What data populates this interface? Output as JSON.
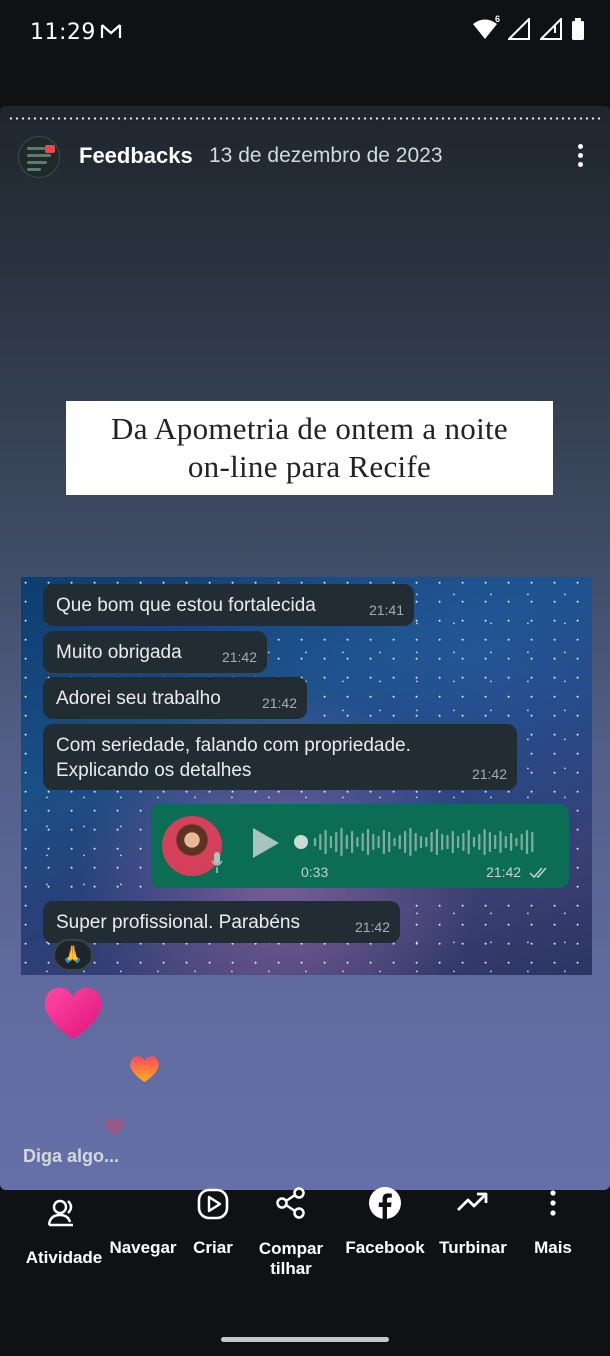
{
  "status_bar": {
    "time": "11:29",
    "wifi_badge": "6"
  },
  "story": {
    "page_name": "Feedbacks",
    "date": "13 de dezembro de 2023",
    "caption_line1": "Da Apometria de ontem a noite",
    "caption_line2": "on-line para Recife",
    "reply_placeholder": "Diga algo..."
  },
  "chat": {
    "messages": [
      {
        "text": "Que bom que estou fortalecida",
        "time": "21:41"
      },
      {
        "text": "Muito obrigada",
        "time": "21:42"
      },
      {
        "text": "Adorei seu trabalho",
        "time": "21:42"
      },
      {
        "text_line1": "Com seriedade,  falando com propriedade.",
        "text_line2": "Explicando os detalhes",
        "time": "21:42"
      },
      {
        "text": "Super profissional.  Parabéns",
        "time": "21:42"
      }
    ],
    "audio": {
      "duration": "0:33",
      "time": "21:42"
    },
    "reaction": "🙏"
  },
  "actions": [
    {
      "label": "Atividade",
      "icon": "activity-icon"
    },
    {
      "label": "Navegar",
      "icon": "navigate-icon"
    },
    {
      "label": "Criar",
      "icon": "create-play-icon"
    },
    {
      "label_line1": "Compar",
      "label_line2": "tilhar",
      "icon": "share-icon"
    },
    {
      "label": "Facebook",
      "icon": "facebook-icon"
    },
    {
      "label": "Turbinar",
      "icon": "boost-trend-icon"
    },
    {
      "label": "Mais",
      "icon": "more-vertical-icon"
    }
  ],
  "colors": {
    "background": "#0f1115",
    "bubble": "#222c33",
    "audio_bubble": "#0b6e54",
    "heart_pink": "#f0338f",
    "heart_orange": "#f7902a"
  }
}
